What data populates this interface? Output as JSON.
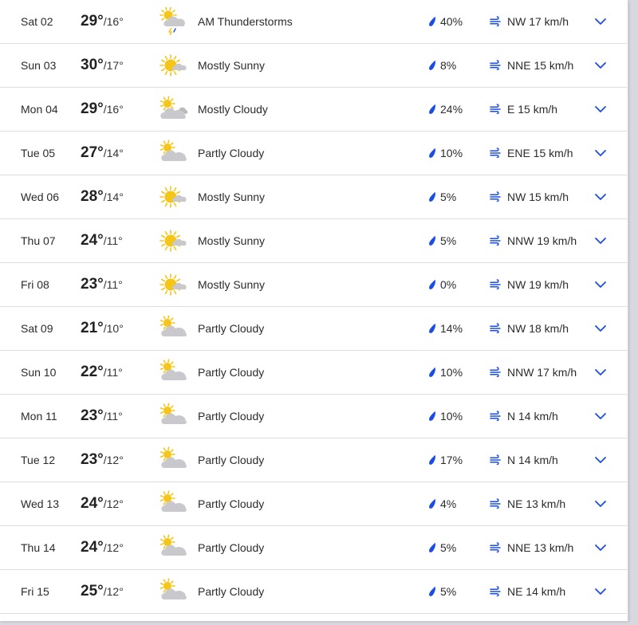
{
  "colors": {
    "accent": "#1b4de4",
    "sun": "#f5c518",
    "cloud": "#c9c9cd",
    "divider": "#dedede"
  },
  "icons": {
    "precip": "raindrop-icon",
    "wind": "wind-icon",
    "expand": "chevron-down-icon"
  },
  "days": [
    {
      "day": "Sat 02",
      "hi": "29°",
      "lo": "/16°",
      "icon": "thunderstorm-icon",
      "phrase": "AM Thunderstorms",
      "precip": "40%",
      "wind": "NW 17 km/h"
    },
    {
      "day": "Sun 03",
      "hi": "30°",
      "lo": "/17°",
      "icon": "mostly-sunny-icon",
      "phrase": "Mostly Sunny",
      "precip": "8%",
      "wind": "NNE 15 km/h"
    },
    {
      "day": "Mon 04",
      "hi": "29°",
      "lo": "/16°",
      "icon": "mostly-cloudy-icon",
      "phrase": "Mostly Cloudy",
      "precip": "24%",
      "wind": "E 15 km/h"
    },
    {
      "day": "Tue 05",
      "hi": "27°",
      "lo": "/14°",
      "icon": "partly-cloudy-icon",
      "phrase": "Partly Cloudy",
      "precip": "10%",
      "wind": "ENE 15 km/h"
    },
    {
      "day": "Wed 06",
      "hi": "28°",
      "lo": "/14°",
      "icon": "mostly-sunny-icon",
      "phrase": "Mostly Sunny",
      "precip": "5%",
      "wind": "NW 15 km/h"
    },
    {
      "day": "Thu 07",
      "hi": "24°",
      "lo": "/11°",
      "icon": "mostly-sunny-icon",
      "phrase": "Mostly Sunny",
      "precip": "5%",
      "wind": "NNW 19 km/h"
    },
    {
      "day": "Fri 08",
      "hi": "23°",
      "lo": "/11°",
      "icon": "mostly-sunny-icon",
      "phrase": "Mostly Sunny",
      "precip": "0%",
      "wind": "NW 19 km/h"
    },
    {
      "day": "Sat 09",
      "hi": "21°",
      "lo": "/10°",
      "icon": "partly-cloudy-icon",
      "phrase": "Partly Cloudy",
      "precip": "14%",
      "wind": "NW 18 km/h"
    },
    {
      "day": "Sun 10",
      "hi": "22°",
      "lo": "/11°",
      "icon": "partly-cloudy-icon",
      "phrase": "Partly Cloudy",
      "precip": "10%",
      "wind": "NNW 17 km/h"
    },
    {
      "day": "Mon 11",
      "hi": "23°",
      "lo": "/11°",
      "icon": "partly-cloudy-icon",
      "phrase": "Partly Cloudy",
      "precip": "10%",
      "wind": "N 14 km/h"
    },
    {
      "day": "Tue 12",
      "hi": "23°",
      "lo": "/12°",
      "icon": "partly-cloudy-icon",
      "phrase": "Partly Cloudy",
      "precip": "17%",
      "wind": "N 14 km/h"
    },
    {
      "day": "Wed 13",
      "hi": "24°",
      "lo": "/12°",
      "icon": "partly-cloudy-icon",
      "phrase": "Partly Cloudy",
      "precip": "4%",
      "wind": "NE 13 km/h"
    },
    {
      "day": "Thu 14",
      "hi": "24°",
      "lo": "/12°",
      "icon": "partly-cloudy-icon",
      "phrase": "Partly Cloudy",
      "precip": "5%",
      "wind": "NNE 13 km/h"
    },
    {
      "day": "Fri 15",
      "hi": "25°",
      "lo": "/12°",
      "icon": "partly-cloudy-icon",
      "phrase": "Partly Cloudy",
      "precip": "5%",
      "wind": "NE 14 km/h"
    }
  ]
}
